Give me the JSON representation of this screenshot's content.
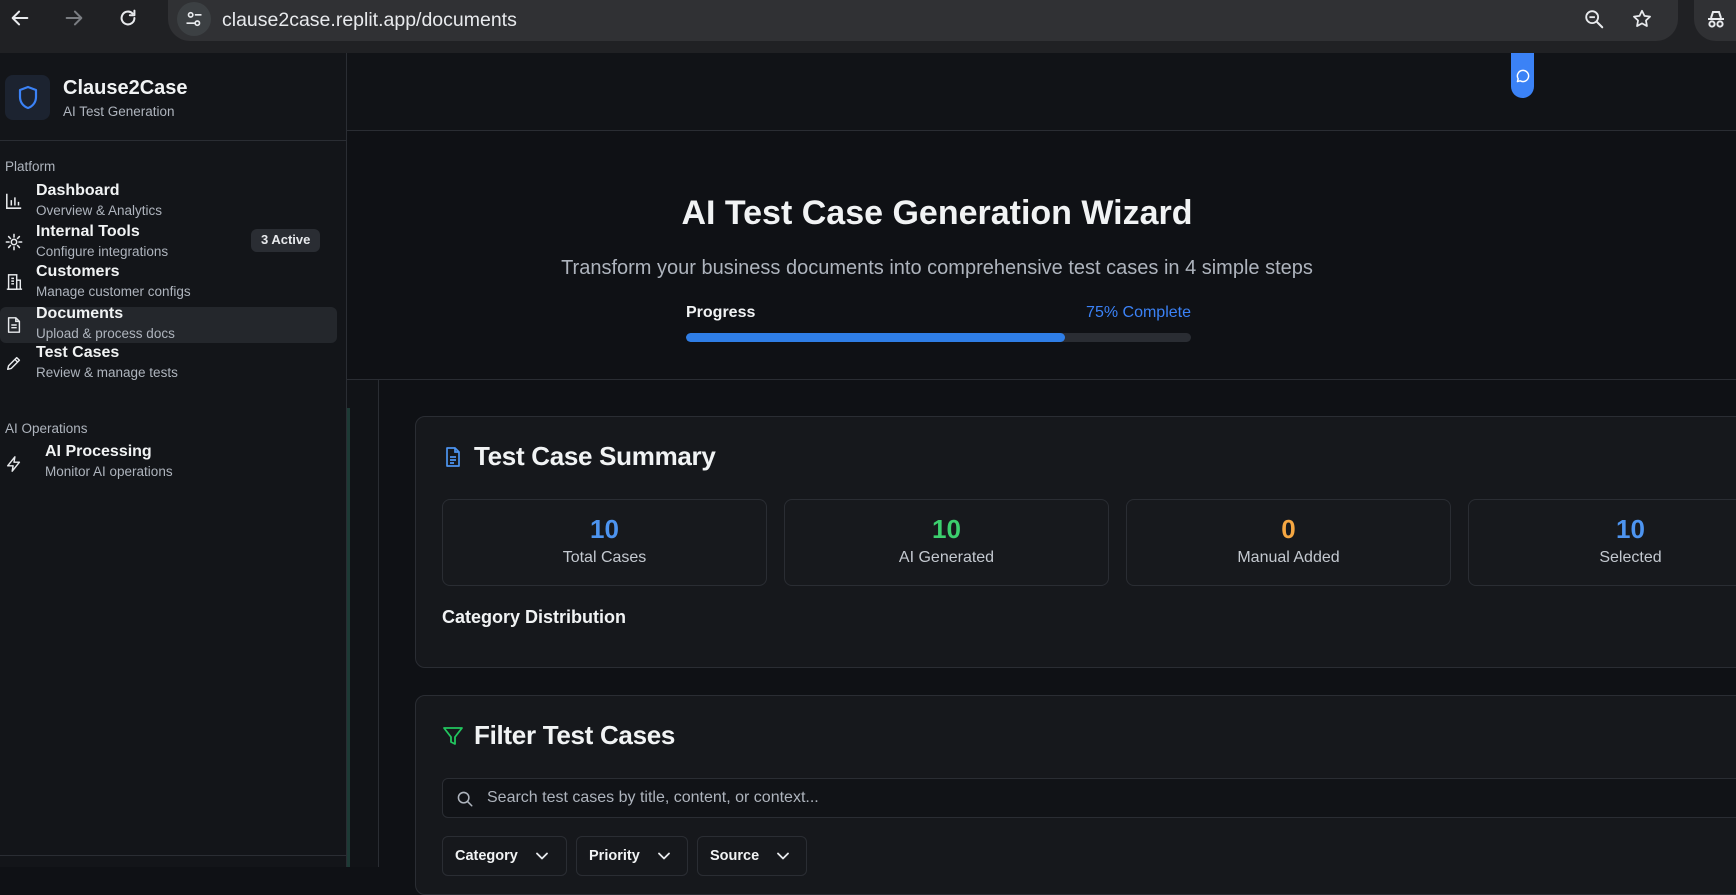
{
  "browser": {
    "url": "clause2case.replit.app/documents"
  },
  "brand": {
    "name": "Clause2Case",
    "subtitle": "AI Test Generation"
  },
  "sidebar": {
    "sections": [
      {
        "label": "Platform",
        "items": [
          {
            "label": "Dashboard",
            "sub": "Overview & Analytics",
            "icon": "bar-chart-icon"
          },
          {
            "label": "Internal Tools",
            "sub": "Configure integrations",
            "icon": "gear-icon",
            "badge": "3 Active"
          },
          {
            "label": "Customers",
            "sub": "Manage customer configs",
            "icon": "building-icon"
          },
          {
            "label": "Documents",
            "sub": "Upload & process docs",
            "icon": "document-icon",
            "active": true
          },
          {
            "label": "Test Cases",
            "sub": "Review & manage tests",
            "icon": "pencil-icon"
          }
        ]
      },
      {
        "label": "AI Operations",
        "items": [
          {
            "label": "AI Processing",
            "sub": "Monitor AI operations",
            "icon": "lightning-icon"
          }
        ]
      }
    ]
  },
  "wizard": {
    "title": "AI Test Case Generation Wizard",
    "subtitle": "Transform your business documents into comprehensive test cases in 4 simple steps",
    "progress_label": "Progress",
    "progress_text": "75% Complete",
    "progress_value": 0.75
  },
  "summary": {
    "title": "Test Case Summary",
    "stats": [
      {
        "value": "10",
        "label": "Total Cases",
        "color": "#4d94f0"
      },
      {
        "value": "10",
        "label": "AI Generated",
        "color": "#3ccf6e"
      },
      {
        "value": "0",
        "label": "Manual Added",
        "color": "#f5a742"
      },
      {
        "value": "10",
        "label": "Selected",
        "color": "#4d94f0"
      }
    ],
    "distribution_title": "Category Distribution"
  },
  "filter": {
    "title": "Filter Test Cases",
    "search_placeholder": "Search test cases by title, content, or context...",
    "selects": [
      {
        "label": "Category"
      },
      {
        "label": "Priority"
      },
      {
        "label": "Source"
      }
    ]
  },
  "colors": {
    "accent": "#3b82f6",
    "filter_icon": "#22c55e"
  }
}
